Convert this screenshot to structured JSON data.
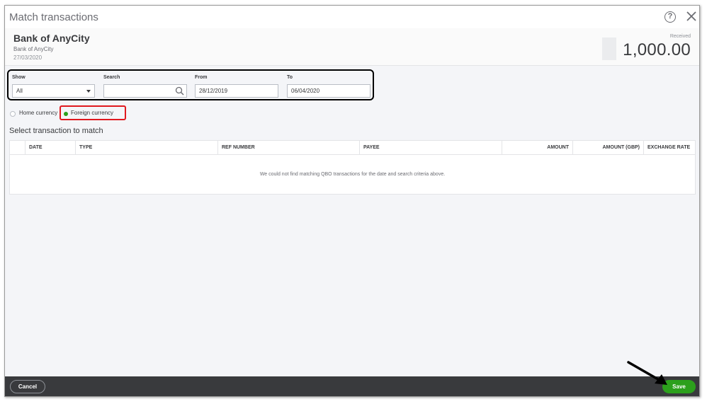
{
  "dialog": {
    "title": "Match transactions"
  },
  "header": {
    "bank_name": "Bank of AnyCity",
    "bank_sub": "Bank of AnyCity",
    "date": "27/03/2020",
    "received_label": "Received",
    "amount": "1,000.00"
  },
  "filters": {
    "show_label": "Show",
    "show_value": "All",
    "search_label": "Search",
    "search_value": "",
    "from_label": "From",
    "from_value": "28/12/2019",
    "to_label": "To",
    "to_value": "06/04/2020"
  },
  "currency": {
    "home_label": "Home currency",
    "foreign_label": "Foreign currency",
    "selected": "foreign"
  },
  "section": {
    "title": "Select transaction to match"
  },
  "table": {
    "columns": [
      "",
      "DATE",
      "TYPE",
      "REF NUMBER",
      "PAYEE",
      "AMOUNT",
      "AMOUNT (GBP)",
      "EXCHANGE RATE"
    ],
    "empty_message": "We could not find matching QBO transactions for the date and search criteria above."
  },
  "footer": {
    "cancel_label": "Cancel",
    "save_label": "Save"
  },
  "colors": {
    "accent_green": "#2ca01c",
    "highlight_red": "#e0191f",
    "footer_bg": "#393a3d"
  }
}
